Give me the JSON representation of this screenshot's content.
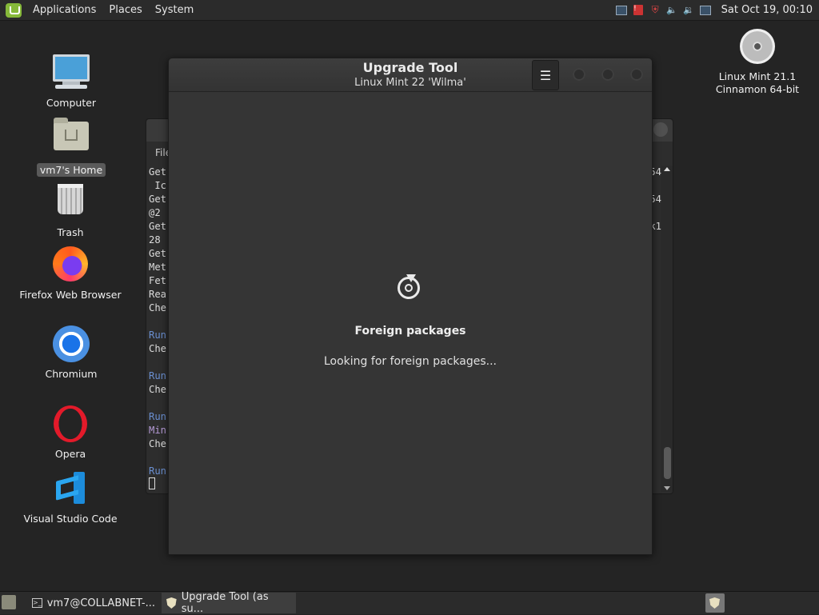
{
  "top_panel": {
    "menus": [
      "Applications",
      "Places",
      "System"
    ],
    "clock": "Sat Oct 19, 00:10"
  },
  "desktop_icons": {
    "computer": "Computer",
    "home": "vm7's Home",
    "trash": "Trash",
    "firefox": "Firefox Web Browser",
    "chromium": "Chromium",
    "opera": "Opera",
    "vscode": "Visual Studio Code",
    "disc_line1": "Linux Mint 21.1",
    "disc_line2": "Cinnamon 64-bit"
  },
  "terminal": {
    "menu": "File",
    "lines_left": [
      "Get",
      " Ic",
      "Get",
      "@2",
      "Get",
      "28",
      "Get",
      "Met",
      "Fet",
      "Rea",
      "Che",
      "",
      "Run",
      "Che",
      "",
      "Run",
      "Che",
      "",
      "Run",
      "Min",
      "Che",
      "",
      "Run"
    ],
    "lines_right": [
      "54",
      "",
      "54",
      "",
      "k1",
      "",
      "",
      "",
      "",
      "",
      "",
      "",
      "",
      "",
      "",
      "",
      "",
      "",
      "",
      "",
      "",
      "",
      ""
    ]
  },
  "upgrade_window": {
    "title": "Upgrade Tool",
    "subtitle": "Linux Mint 22 'Wilma'",
    "menu_icon": "☰",
    "status_title": "Foreign packages",
    "status_text": "Looking for foreign packages..."
  },
  "taskbar": {
    "items": [
      "vm7@COLLABNET-...",
      "Upgrade Tool (as su..."
    ]
  },
  "colors": {
    "desktop_bg": "#242424",
    "panel_bg": "#2b2b2b",
    "window_bg": "#353535",
    "accent_mint": "#86b93a"
  }
}
